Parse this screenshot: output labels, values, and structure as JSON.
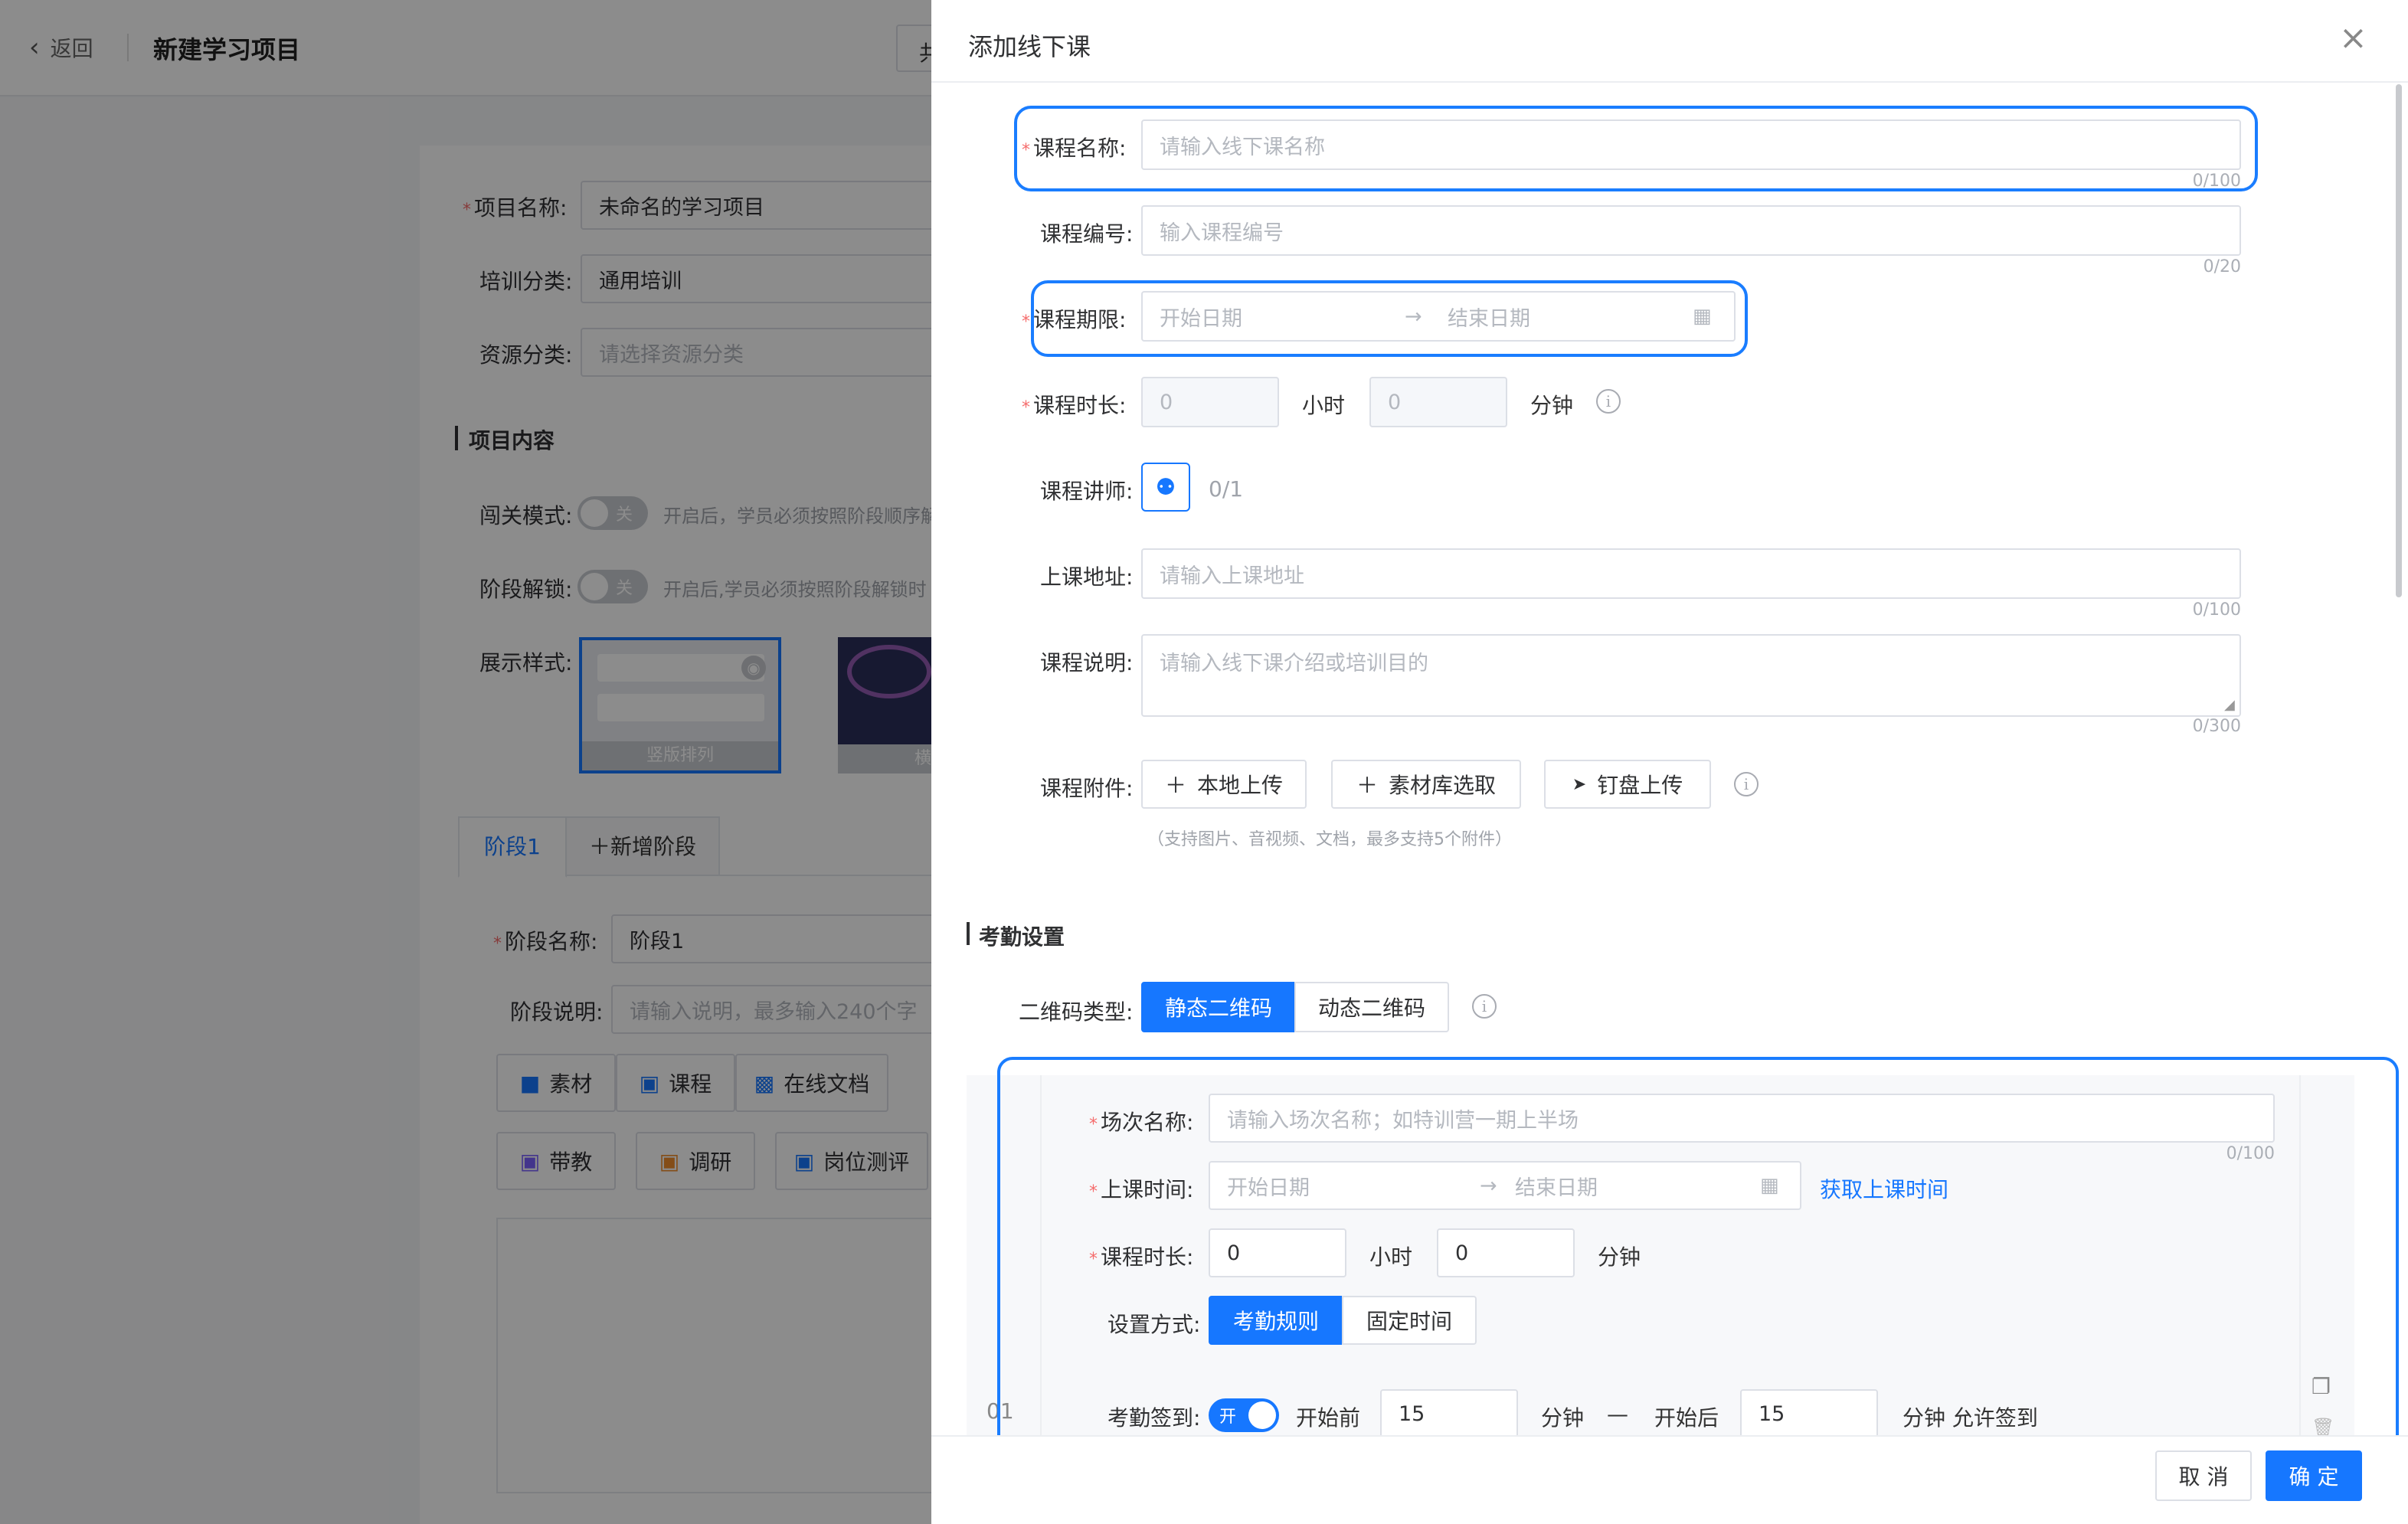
{
  "bg": {
    "back": "返回",
    "title": "新建学习项目",
    "header_cut": "共",
    "fields": {
      "name_label": "项目名称:",
      "name_value": "未命名的学习项目",
      "category_label": "培训分类:",
      "category_value": "通用培训",
      "resource_label": "资源分类:",
      "resource_placeholder": "请选择资源分类"
    },
    "section": "项目内容",
    "gate_label": "闯关模式:",
    "gate_toggle": "关",
    "gate_hint": "开启后，学员必须按照阶段顺序解",
    "unlock_label": "阶段解锁:",
    "unlock_toggle": "关",
    "unlock_hint": "开启后,学员必须按照阶段解锁时",
    "style_label": "展示样式:",
    "style_option1": "竖版排列",
    "style_option2_cut": "横",
    "tabs": [
      "阶段1",
      "新增阶段"
    ],
    "stage_name_label": "阶段名称:",
    "stage_name_value": "阶段1",
    "stage_desc_label": "阶段说明:",
    "stage_desc_placeholder": "请输入说明，最多输入240个字",
    "tools_row1": [
      "素材",
      "课程",
      "在线文档"
    ],
    "tools_row2": [
      "带教",
      "调研",
      "岗位测评"
    ]
  },
  "drawer": {
    "title": "添加线下课",
    "name_label": "课程名称:",
    "name_placeholder": "请输入线下课名称",
    "name_counter": "0/100",
    "code_label": "课程编号:",
    "code_placeholder": "输入课程编号",
    "code_counter": "0/20",
    "period_label": "课程期限:",
    "start_placeholder": "开始日期",
    "end_placeholder": "结束日期",
    "duration_label": "课程时长:",
    "duration_hours": "0",
    "hours_unit": "小时",
    "duration_minutes": "0",
    "minutes_unit": "分钟",
    "teacher_label": "课程讲师:",
    "teacher_count": "0/1",
    "address_label": "上课地址:",
    "address_placeholder": "请输入上课地址",
    "address_counter": "0/100",
    "desc_label": "课程说明:",
    "desc_placeholder": "请输入线下课介绍或培训目的",
    "desc_counter": "0/300",
    "attach_label": "课程附件:",
    "attach_local": "本地上传",
    "attach_library": "素材库选取",
    "attach_dingpan": "钉盘上传",
    "attach_hint": "（支持图片、音视频、文档，最多支持5个附件）",
    "attendance_title": "考勤设置",
    "qr_label": "二维码类型:",
    "qr_static": "静态二维码",
    "qr_dynamic": "动态二维码",
    "session": {
      "index": "01",
      "name_label": "场次名称:",
      "name_placeholder": "请输入场次名称；如特训营一期上半场",
      "name_counter": "0/100",
      "time_label": "上课时间:",
      "start_placeholder": "开始日期",
      "end_placeholder": "结束日期",
      "fetch_time": "获取上课时间",
      "duration_label": "课程时长:",
      "hours": "0",
      "hours_unit": "小时",
      "minutes": "0",
      "minutes_unit": "分钟",
      "mode_label": "设置方式:",
      "mode_rule": "考勤规则",
      "mode_fixed": "固定时间",
      "checkin_label": "考勤签到:",
      "checkin_toggle": "开",
      "before_label": "开始前",
      "before_value": "15",
      "minutes_word": "分钟",
      "dash": "—",
      "after_label": "开始后",
      "after_value": "15",
      "after_suffix": "分钟 允许签到"
    },
    "cancel": "取 消",
    "confirm": "确 定"
  },
  "colors": {
    "primary": "#1677ff",
    "highlight": "#1a7dff",
    "required": "#f56c6c"
  }
}
